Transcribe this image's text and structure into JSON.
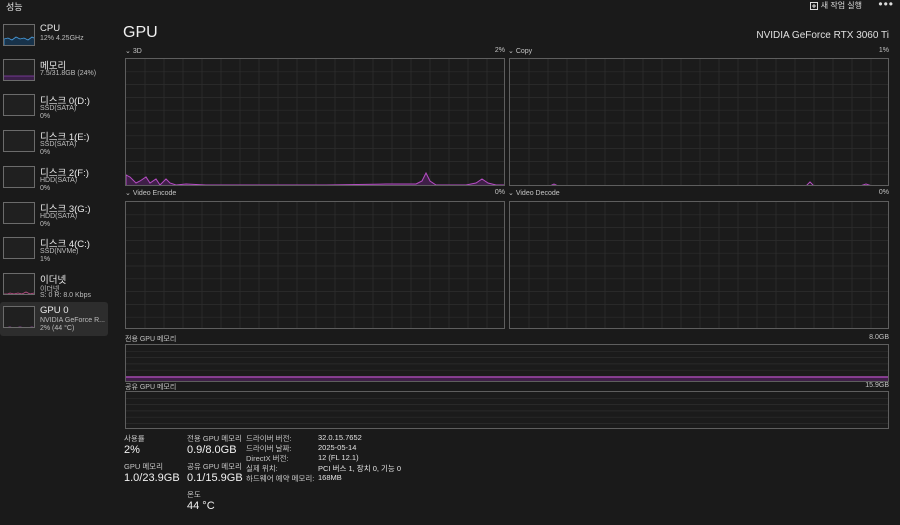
{
  "window": {
    "title": "성능",
    "run_task_label": "새 작업 실행",
    "more_label": "•••"
  },
  "sidebar": {
    "items": [
      {
        "name": "CPU",
        "sub1": "12% 4.25GHz",
        "sub2": ""
      },
      {
        "name": "메모리",
        "sub1": "7.5/31.8GB (24%)",
        "sub2": ""
      },
      {
        "name": "디스크 0(D:)",
        "sub1": "SSD(SATA)",
        "sub2": "0%"
      },
      {
        "name": "디스크 1(E:)",
        "sub1": "SSD(SATA)",
        "sub2": "0%"
      },
      {
        "name": "디스크 2(F:)",
        "sub1": "HDD(SATA)",
        "sub2": "0%"
      },
      {
        "name": "디스크 3(G:)",
        "sub1": "HDD(SATA)",
        "sub2": "0%"
      },
      {
        "name": "디스크 4(C:)",
        "sub1": "SSD(NVMe)",
        "sub2": "1%"
      },
      {
        "name": "이더넷",
        "sub1": "이더넷",
        "sub2": "S: 0 R: 8.0 Kbps"
      },
      {
        "name": "GPU 0",
        "sub1": "NVIDIA GeForce R...",
        "sub2": "2% (44 °C)"
      }
    ]
  },
  "main": {
    "title": "GPU",
    "model": "NVIDIA GeForce RTX 3060 Ti",
    "charts": [
      {
        "label": "3D",
        "pct": "2%"
      },
      {
        "label": "Copy",
        "pct": "1%"
      },
      {
        "label": "Video Encode",
        "pct": "0%"
      },
      {
        "label": "Video Decode",
        "pct": "0%"
      }
    ],
    "dedicated_mem": {
      "label": "전용 GPU 메모리",
      "max": "8.0GB"
    },
    "shared_mem": {
      "label": "공유 GPU 메모리",
      "max": "15.9GB"
    }
  },
  "stats": {
    "usage_label": "사용률",
    "usage_value": "2%",
    "gpu_mem_label": "GPU 메모리",
    "gpu_mem_value": "1.0/23.9GB",
    "dedicated_label": "전용 GPU 메모리",
    "dedicated_value": "0.9/8.0GB",
    "shared_label": "공유 GPU 메모리",
    "shared_value": "0.1/15.9GB",
    "temp_label": "온도",
    "temp_value": "44 °C"
  },
  "info": [
    {
      "key": "드라이버 버전:",
      "value": "32.0.15.7652"
    },
    {
      "key": "드라이버 날짜:",
      "value": "2025-05-14"
    },
    {
      "key": "DirectX 버전:",
      "value": "12 (FL 12.1)"
    },
    {
      "key": "실제 위치:",
      "value": "PCI 버스 1, 장치 0, 기능 0"
    },
    {
      "key": "하드웨어 예약 메모리:",
      "value": "168MB"
    }
  ],
  "colors": {
    "gpu_accent": "#b64dc4",
    "cpu_accent": "#4a9fe0",
    "memory_accent": "#8a3fb0",
    "ethernet_accent": "#c0508a"
  }
}
